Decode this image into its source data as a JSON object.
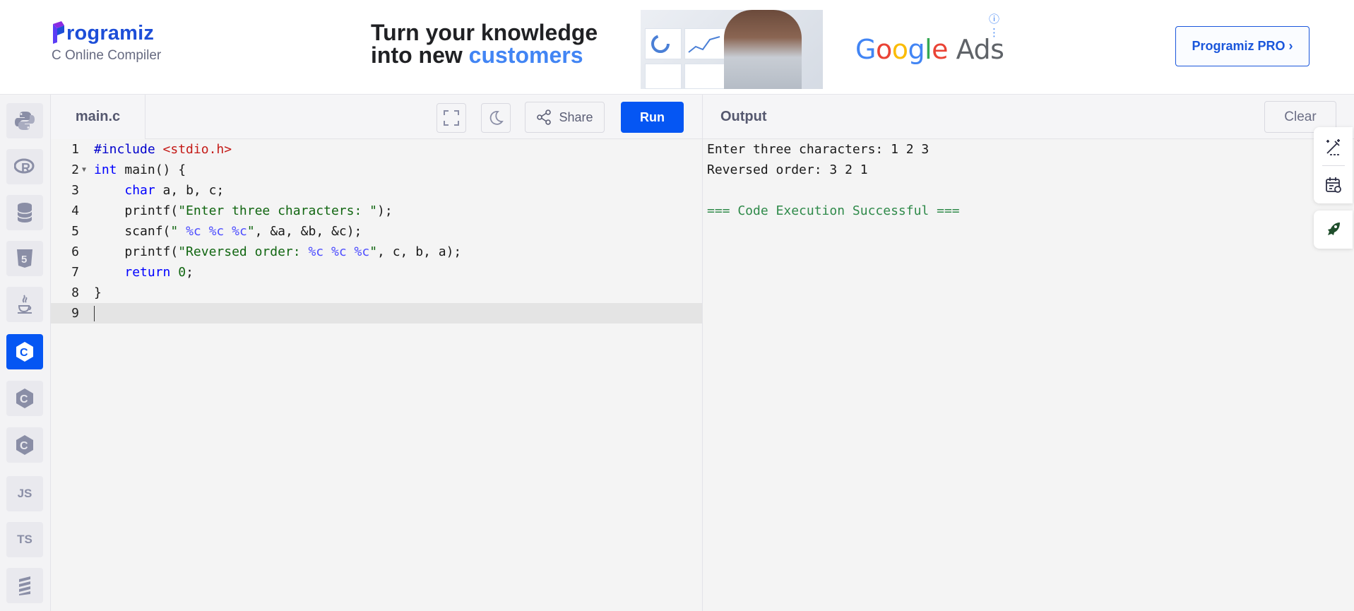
{
  "brand": {
    "name": "rogramiz",
    "subtitle": "C Online Compiler"
  },
  "ad": {
    "headline_line1": "Turn your knowledge",
    "headline_line2_prefix": "into new ",
    "headline_line2_highlight": "customers",
    "google_G": "G",
    "google_o1": "o",
    "google_o2": "o",
    "google_g": "g",
    "google_l": "l",
    "google_e": "e",
    "google_ads": "Ads",
    "info_icon": "ⓘ ⋮"
  },
  "header": {
    "pro_button": "Programiz PRO ›"
  },
  "sidebar": {
    "items": [
      {
        "name": "python",
        "label": ""
      },
      {
        "name": "r",
        "label": "R"
      },
      {
        "name": "sql",
        "label": ""
      },
      {
        "name": "html",
        "label": "5"
      },
      {
        "name": "java",
        "label": ""
      },
      {
        "name": "c",
        "label": "C",
        "active": true
      },
      {
        "name": "cpp",
        "label": "C"
      },
      {
        "name": "csharp",
        "label": "C"
      },
      {
        "name": "js",
        "label": "JS"
      },
      {
        "name": "ts",
        "label": "TS"
      },
      {
        "name": "swift",
        "label": ""
      }
    ]
  },
  "editor": {
    "file_tab": "main.c",
    "share_label": "Share",
    "run_label": "Run",
    "line_numbers": [
      "1",
      "2",
      "3",
      "4",
      "5",
      "6",
      "7",
      "8",
      "9"
    ],
    "lines": [
      "#include <stdio.h>",
      "int main() {",
      "    char a, b, c;",
      "    printf(\"Enter three characters: \");",
      "    scanf(\" %c %c %c\", &a, &b, &c);",
      "    printf(\"Reversed order: %c %c %c\", c, b, a);",
      "    return 0;",
      "}",
      ""
    ]
  },
  "output": {
    "title": "Output",
    "clear_label": "Clear",
    "lines": [
      "Enter three characters: 1 2 3",
      "Reversed order: 3 2 1",
      "",
      "=== Code Execution Successful ==="
    ]
  },
  "colors": {
    "accent": "#0556f3",
    "success": "#2f8a4a"
  }
}
